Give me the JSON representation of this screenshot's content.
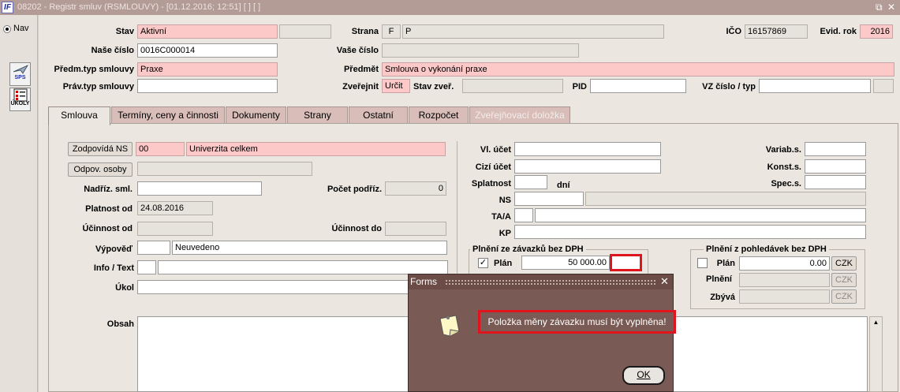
{
  "window": {
    "title": "08202 - Registr smluv (RSMLOUVY) - [01.12.2016; 12:51]  [ ]  [ ]",
    "app_icon": "IF",
    "restore_icon": "restore-icon",
    "close_icon": "close-icon"
  },
  "left": {
    "nav_label": "Nav",
    "sps_label": "SPS",
    "ukoly_label": "ÚKOLY"
  },
  "header": {
    "stav_label": "Stav",
    "stav_value": "Aktivní",
    "stav_extra": "",
    "strana_label": "Strana",
    "strana_code": "F",
    "strana_value": "P",
    "ico_label": "IČO",
    "ico_value": "16157869",
    "evid_label": "Evid. rok",
    "evid_value": "2016",
    "nase_label": "Naše číslo",
    "nase_value": "0016C000014",
    "vase_label": "Vaše číslo",
    "vase_value": "",
    "predmtyp_label": "Předm.typ smlouvy",
    "predmtyp_value": "Praxe",
    "predmet_label": "Předmět",
    "predmet_value": "Smlouva o vykonání praxe",
    "pravtyp_label": "Práv.typ smlouvy",
    "pravtyp_value": "",
    "zverejnit_label": "Zveřejnit",
    "zverejnit_value": "Určit",
    "stavzver_label": "Stav zveř.",
    "stavzver_value": "",
    "pid_label": "PID",
    "pid_value": "",
    "vz_label": "VZ číslo / typ",
    "vz_value": "",
    "vz_type": ""
  },
  "tabs": [
    {
      "label": "Smlouva"
    },
    {
      "label": "Termíny, ceny a činnosti"
    },
    {
      "label": "Dokumenty"
    },
    {
      "label": "Strany"
    },
    {
      "label": "Ostatní"
    },
    {
      "label": "Rozpočet"
    },
    {
      "label": "Zveřejňovací doložka"
    }
  ],
  "smlouva": {
    "zodpovida_btn": "Zodpovídá NS",
    "zodpovida_code": "00",
    "zodpovida_value": "Univerzita celkem",
    "odpov_btn": "Odpov. osoby",
    "odpov_value": "",
    "nadriz_label": "Nadříz. sml.",
    "nadriz_value": "",
    "pocet_label": "Počet podříz.",
    "pocet_value": "0",
    "platnost_label": "Platnost od",
    "platnost_value": "24.08.2016",
    "ucinnost_od_label": "Účinnost od",
    "ucinnost_od_value": "",
    "ucinnost_do_label": "Účinnost do",
    "ucinnost_do_value": "",
    "vypoved_label": "Výpověď",
    "vypoved_code": "",
    "vypoved_value": "Neuvedeno",
    "info_label": "Info / Text",
    "info_code": "",
    "info_value": "",
    "ukol_label": "Úkol",
    "ukol_value": "",
    "obsah_label": "Obsah",
    "obsah_value": "",
    "vlucet_label": "Vl. účet",
    "vlucet_value": "",
    "cizi_label": "Cizí účet",
    "cizi_value": "",
    "splatnost_label": "Splatnost",
    "splatnost_value": "",
    "dni_label": "dní",
    "ns_label": "NS",
    "ns_value": "",
    "ns_extra": "",
    "taa_label": "TA/A",
    "taa_code": "",
    "taa_value": "",
    "kp_label": "KP",
    "kp_value": "",
    "variab_label": "Variab.s.",
    "variab_value": "",
    "konst_label": "Konst.s.",
    "konst_value": "",
    "spec_label": "Spec.s.",
    "spec_value": "",
    "zavazky_title": "Plnění ze závazků bez DPH",
    "zavazky_plan_label": "Plán",
    "zavazky_plan_value": "50 000.00",
    "zavazky_currency": "",
    "pohledavky_title": "Plnění z pohledávek bez DPH",
    "pohl_plan_label": "Plán",
    "pohl_plan_value": "0.00",
    "pohl_plan_currency": "CZK",
    "pohl_plneni_label": "Plnění",
    "pohl_plneni_value": "",
    "pohl_plneni_currency": "CZK",
    "pohl_zbyva_label": "Zbývá",
    "pohl_zbyva_value": "",
    "pohl_zbyva_currency": "CZK",
    "checkmark": "✓"
  },
  "dialog": {
    "title": "Forms",
    "close_glyph": "✕",
    "message": "Položka měny závazku musí být vyplněna!",
    "ok_label": "OK",
    "icon": "note-icon"
  }
}
